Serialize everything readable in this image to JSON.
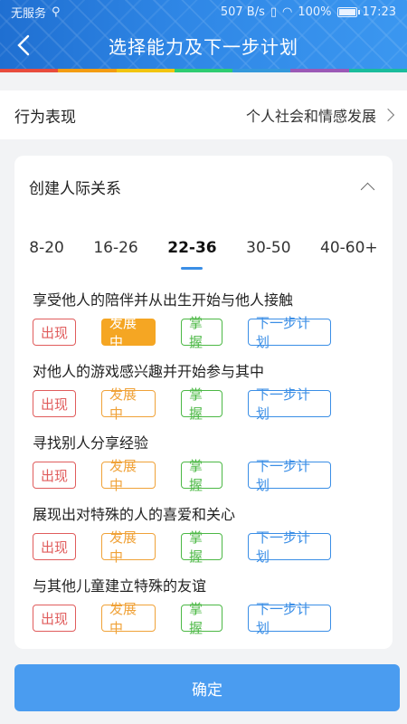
{
  "statusbar": {
    "carrier": "无服务",
    "speed": "507 B/s",
    "battery": "100%",
    "battery_level": 1.0,
    "time": "17:23"
  },
  "header": {
    "title": "选择能力及下一步计划"
  },
  "behavior": {
    "label": "行为表现",
    "value": "个人社会和情感发展"
  },
  "card": {
    "title": "创建人际关系",
    "tabs": [
      "8-20",
      "16-26",
      "22-36",
      "30-50",
      "40-60+"
    ],
    "active_tab": 2,
    "buttons": {
      "emerge": "出现",
      "developing": "发展中",
      "master": "掌握",
      "next": "下一步计划"
    },
    "items": [
      {
        "text": "享受他人的陪伴并从出生开始与他人接触",
        "selected": "developing"
      },
      {
        "text": "对他人的游戏感兴趣并开始参与其中",
        "selected": ""
      },
      {
        "text": "寻找别人分享经验",
        "selected": ""
      },
      {
        "text": "展现出对特殊的人的喜爱和关心",
        "selected": ""
      },
      {
        "text": "与其他儿童建立特殊的友谊",
        "selected": ""
      }
    ]
  },
  "confirm_label": "确定",
  "colors": {
    "primary": "#3a8ee6",
    "emerge": "#e05c5c",
    "developing": "#f5a623",
    "master": "#4cb845",
    "rainbow": [
      "#e84c3d",
      "#f39c12",
      "#f1c40f",
      "#2ecc71",
      "#3498db",
      "#9b59b6",
      "#1abc9c"
    ]
  }
}
